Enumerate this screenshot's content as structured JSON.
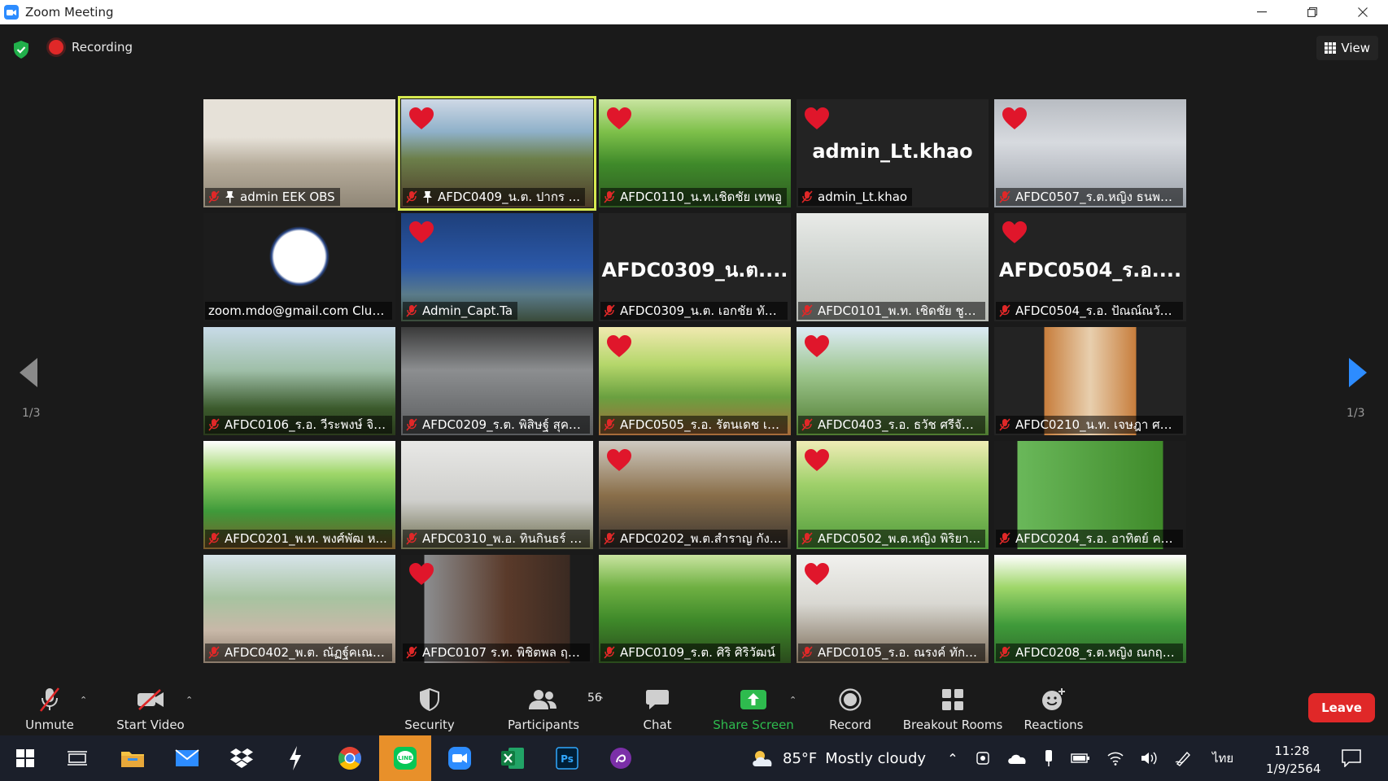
{
  "window": {
    "title": "Zoom Meeting"
  },
  "topbar": {
    "recording_label": "Recording",
    "view_label": "View"
  },
  "pagination": {
    "current": "1/3",
    "total_pages": 3
  },
  "tiles": [
    {
      "name": "admin EEK OBS",
      "muted": true,
      "pinned": true,
      "heart": false,
      "active": false,
      "big_name": ""
    },
    {
      "name": "AFDC0409_น.ต. ปากร ...",
      "muted": true,
      "pinned": true,
      "heart": true,
      "active": true,
      "big_name": ""
    },
    {
      "name": "AFDC0110_น.ท.เชิดชัย เทพอู",
      "muted": true,
      "pinned": false,
      "heart": true,
      "active": false,
      "big_name": ""
    },
    {
      "name": "admin_Lt.khao",
      "muted": true,
      "pinned": false,
      "heart": true,
      "active": false,
      "big_name": "admin_Lt.khao"
    },
    {
      "name": "AFDC0507_ร.ต.หญิง ธนพร ...",
      "muted": true,
      "pinned": false,
      "heart": true,
      "active": false,
      "big_name": ""
    },
    {
      "name": "zoom.mdo@gmail.com Clust...",
      "muted": false,
      "pinned": false,
      "heart": false,
      "active": false,
      "big_name": ""
    },
    {
      "name": "Admin_Capt.Ta",
      "muted": true,
      "pinned": false,
      "heart": true,
      "active": false,
      "big_name": ""
    },
    {
      "name": "AFDC0309_น.ต. เอกชัย ทัศ...",
      "muted": true,
      "pinned": false,
      "heart": false,
      "active": false,
      "big_name": "AFDC0309_น.ต...."
    },
    {
      "name": "AFDC0101_พ.ท. เชิดชัย ชูทิ...",
      "muted": true,
      "pinned": false,
      "heart": false,
      "active": false,
      "big_name": ""
    },
    {
      "name": "AFDC0504_ร.อ. ปัณณ์ณวัส...",
      "muted": true,
      "pinned": false,
      "heart": true,
      "active": false,
      "big_name": "AFDC0504_ร.อ...."
    },
    {
      "name": "AFDC0106_ร.อ. วีระพงษ์ จิตร...",
      "muted": true,
      "pinned": false,
      "heart": false,
      "active": false,
      "big_name": ""
    },
    {
      "name": "AFDC0209_ร.ต. พิสิษฐ์ สุคน...",
      "muted": true,
      "pinned": false,
      "heart": false,
      "active": false,
      "big_name": ""
    },
    {
      "name": "AFDC0505_ร.อ. รัตนเดช เด...",
      "muted": true,
      "pinned": false,
      "heart": true,
      "active": false,
      "big_name": ""
    },
    {
      "name": "AFDC0403_ร.อ. ธวัช ศรีจันทร์",
      "muted": true,
      "pinned": false,
      "heart": true,
      "active": false,
      "big_name": ""
    },
    {
      "name": "AFDC0210_น.ท. เจษฎา ศรีท...",
      "muted": true,
      "pinned": false,
      "heart": false,
      "active": false,
      "big_name": ""
    },
    {
      "name": "AFDC0201_พ.ท. พงศ์พัฒ ห...",
      "muted": true,
      "pinned": false,
      "heart": false,
      "active": false,
      "big_name": ""
    },
    {
      "name": "AFDC0310_พ.อ. ทินกินธร์ ใ...",
      "muted": true,
      "pinned": false,
      "heart": false,
      "active": false,
      "big_name": ""
    },
    {
      "name": "AFDC0202_พ.ต.สำราญ กังเ...",
      "muted": true,
      "pinned": false,
      "heart": true,
      "active": false,
      "big_name": ""
    },
    {
      "name": "AFDC0502_พ.ต.หญิง พิริยา...",
      "muted": true,
      "pinned": false,
      "heart": true,
      "active": false,
      "big_name": ""
    },
    {
      "name": "AFDC0204_ร.อ. อาทิตย์ คน...",
      "muted": true,
      "pinned": false,
      "heart": false,
      "active": false,
      "big_name": ""
    },
    {
      "name": "AFDC0402_พ.ต. ณัฏฐ์คเณศ...",
      "muted": true,
      "pinned": false,
      "heart": false,
      "active": false,
      "big_name": ""
    },
    {
      "name": "AFDC0107 ร.ท. พิชิตพล ฤท...",
      "muted": true,
      "pinned": false,
      "heart": true,
      "active": false,
      "big_name": ""
    },
    {
      "name": "AFDC0109_ร.ต. ศิริ ศิริวัฒน์",
      "muted": true,
      "pinned": false,
      "heart": false,
      "active": false,
      "big_name": ""
    },
    {
      "name": "AFDC0105_ร.อ. ณรงค์ ทักษิ...",
      "muted": true,
      "pinned": false,
      "heart": true,
      "active": false,
      "big_name": ""
    },
    {
      "name": "AFDC0208_ร.ต.หญิง ณกฤต...",
      "muted": true,
      "pinned": false,
      "heart": false,
      "active": false,
      "big_name": ""
    }
  ],
  "toolbar": {
    "unmute": "Unmute",
    "start_video": "Start Video",
    "security": "Security",
    "participants": "Participants",
    "participants_count": "56",
    "chat": "Chat",
    "share_screen": "Share Screen",
    "record": "Record",
    "breakout_rooms": "Breakout Rooms",
    "reactions": "Reactions",
    "leave": "Leave"
  },
  "taskbar": {
    "weather_temp": "85°F",
    "weather_text": "Mostly cloudy",
    "input_lang": "ไทย",
    "time": "11:28",
    "date": "1/9/2564"
  },
  "colors": {
    "accent_blue": "#2d8cff",
    "share_green": "#2ebb4e",
    "leave_red": "#e02828",
    "active_speaker": "#d6e94f",
    "mute_red": "#e02828"
  }
}
